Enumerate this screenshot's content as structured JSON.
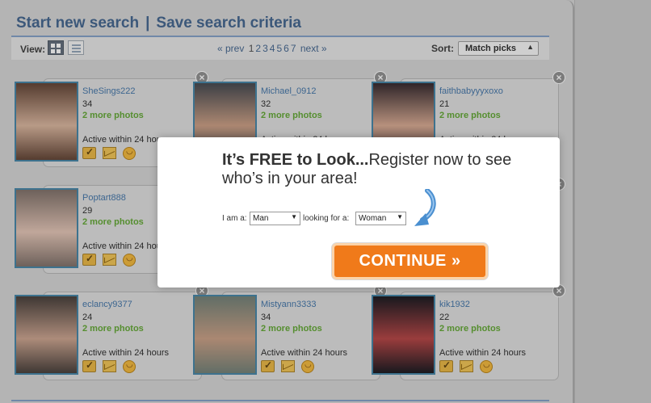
{
  "header": {
    "start_search": "Start new search",
    "separator": "|",
    "save_criteria": "Save search criteria"
  },
  "toolbar": {
    "view_label": "View:",
    "view_grid_icon": "grid-icon",
    "view_list_icon": "list-icon",
    "pager": {
      "prev": "« prev",
      "pages": [
        "1",
        "2",
        "3",
        "4",
        "5",
        "6",
        "7"
      ],
      "current": "1",
      "next": "next »"
    },
    "sort_label": "Sort:",
    "sort_value": "Match picks"
  },
  "profiles": [
    {
      "username": "SheSings222",
      "age": "34",
      "more_photos": "2 more photos",
      "active": "Active within 24 hours",
      "photo_colors": [
        "#5a3a2a",
        "#d9b39a"
      ]
    },
    {
      "username": "Michael_0912",
      "age": "32",
      "more_photos": "2 more photos",
      "active": "Active within 24 hours",
      "photo_colors": [
        "#3b3f46",
        "#c99a7e"
      ]
    },
    {
      "username": "faithbabyyyxoxo",
      "age": "21",
      "more_photos": "2 more photos",
      "active": "Active within 24 hours",
      "photo_colors": [
        "#2a1d22",
        "#d7a68d"
      ]
    },
    {
      "username": "Poptart888",
      "age": "29",
      "more_photos": "2 more photos",
      "active": "Active within 24 hours",
      "photo_colors": [
        "#7a6a62",
        "#e3c3b3"
      ]
    },
    {
      "username": "",
      "age": "",
      "more_photos": "",
      "active": "",
      "photo_colors": [
        "#d4d4d4",
        "#d4d4d4"
      ]
    },
    {
      "username": "",
      "age": "",
      "more_photos": "",
      "active": "",
      "photo_colors": [
        "#d4d4d4",
        "#d4d4d4"
      ]
    },
    {
      "username": "eclancy9377",
      "age": "24",
      "more_photos": "2 more photos",
      "active": "Active within 24 hours",
      "photo_colors": [
        "#3e3530",
        "#caa08a"
      ]
    },
    {
      "username": "Mistyann3333",
      "age": "34",
      "more_photos": "2 more photos",
      "active": "Active within 24 hours",
      "photo_colors": [
        "#6b7a70",
        "#c79b7f"
      ]
    },
    {
      "username": "kik1932",
      "age": "22",
      "more_photos": "2 more photos",
      "active": "Active within 24 hours",
      "photo_colors": [
        "#0d0d14",
        "#b23b3b"
      ]
    }
  ],
  "card_icons": [
    "favorite-icon",
    "mail-icon",
    "wink-icon"
  ],
  "close_glyph": "×",
  "modal": {
    "headline_bold": "It’s FREE to Look...",
    "headline_rest": "Register now to see who’s in your area!",
    "iam_label": "I am a:",
    "iam_value": "Man",
    "looking_for_label": "looking for a:",
    "looking_for_value": "Woman",
    "continue_label": "CONTINUE »"
  },
  "colors": {
    "link_blue": "#3a5e8a",
    "green": "#5aa329",
    "continue_orange": "#f07a1a"
  }
}
